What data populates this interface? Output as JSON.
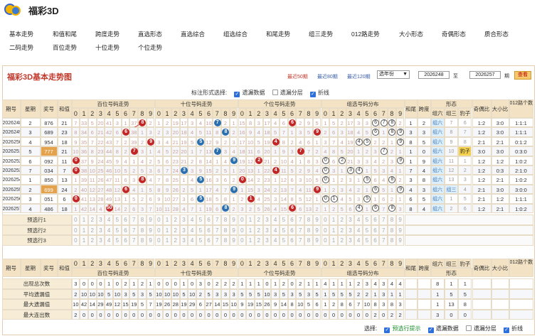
{
  "app": {
    "title": "福彩3D"
  },
  "nav": [
    "基本走势",
    "和值和尾",
    "跨度走势",
    "直选形态",
    "直选综合",
    "组选综合",
    "和尾走势",
    "组三走势",
    "012路走势",
    "大小形态",
    "奇偶形态",
    "质合形态",
    "二码走势",
    "百位走势",
    "十位走势",
    "个位走势"
  ],
  "panel": {
    "title": "福彩3D基本走势图",
    "links": [
      "最近50期",
      "最近80期",
      "最近120期"
    ],
    "year_select": "选年份",
    "from_value": "2026248",
    "to_value": "2026257",
    "to_label": "至",
    "period_label": "期",
    "query_button": "查看"
  },
  "mode": {
    "label": "标注形式选择:",
    "options": [
      {
        "label": "遗漏数据",
        "checked": true
      },
      {
        "label": "遗漏分层",
        "checked": false
      },
      {
        "label": "折线",
        "checked": true
      }
    ]
  },
  "headers": {
    "period": "期号",
    "weekday": "星期",
    "prize": "奖号",
    "sum": "和值",
    "bai": "百位号码走势",
    "shi": "十位号码走势",
    "ge": "个位号码走势",
    "group": "组选号码分布",
    "sumtail": "和尾",
    "span": "跨度",
    "shape": "形态",
    "zu6": "组六",
    "zu3": "组三",
    "leopard": "豹子",
    "odd_even": "奇偶比",
    "big_small": "大小比",
    "road012": "012路个数比"
  },
  "rows": [
    {
      "period": "2026248",
      "weekday": "2",
      "prize": "876",
      "sum": "21",
      "bai": [
        "7",
        "33",
        "5",
        "20",
        "41",
        "3",
        "1",
        "37",
        "8",
        "2"
      ],
      "shi": [
        "1",
        "2",
        "19",
        "17",
        "3",
        "4",
        "10",
        "7",
        "2",
        "1"
      ],
      "ge": [
        "15",
        "8",
        "3",
        "17",
        "4",
        "6",
        "6",
        "2",
        "9",
        "5"
      ],
      "group": [
        "1",
        "5",
        "2",
        "17",
        "3",
        "3",
        "6",
        "7",
        "8",
        "2"
      ],
      "sumtail": "1",
      "span": "2",
      "shape": [
        "组六",
        "7",
        "6"
      ],
      "odd_even": "1:2",
      "big_small": "3:0",
      "road012": "1:1:1"
    },
    {
      "period": "2026249",
      "weekday": "3",
      "prize": "689",
      "sum": "23",
      "bai": [
        "8",
        "34",
        "6",
        "21",
        "42",
        "6",
        "6",
        "38",
        "1",
        "3"
      ],
      "shi": [
        "2",
        "3",
        "20",
        "18",
        "4",
        "5",
        "11",
        "8",
        "8",
        "2"
      ],
      "ge": [
        "16",
        "9",
        "4",
        "18",
        "5",
        "7",
        "1",
        "3",
        "5",
        "9"
      ],
      "group": [
        "2",
        "6",
        "3",
        "18",
        "4",
        "5",
        "6",
        "1",
        "8",
        "9"
      ],
      "sumtail": "3",
      "span": "3",
      "shape": [
        "组六",
        "8",
        "7"
      ],
      "odd_even": "1:2",
      "big_small": "3:0",
      "road012": "1:1:1"
    },
    {
      "period": "2026250",
      "weekday": "4",
      "prize": "954",
      "sum": "18",
      "bai": [
        "9",
        "35",
        "7",
        "22",
        "43",
        "7",
        "2",
        "39",
        "2",
        "9"
      ],
      "shi": [
        "3",
        "4",
        "21",
        "19",
        "5",
        "5",
        "12",
        "9",
        "2",
        "3"
      ],
      "ge": [
        "17",
        "10",
        "5",
        "19",
        "4",
        "8",
        "2",
        "4",
        "6",
        "1"
      ],
      "group": [
        "3",
        "7",
        "4",
        "19",
        "4",
        "5",
        "2",
        "2",
        "1",
        "9"
      ],
      "sumtail": "8",
      "span": "5",
      "shape": [
        "组六",
        "9",
        "8"
      ],
      "odd_even": "2:1",
      "big_small": "2:1",
      "road012": "0:1:2"
    },
    {
      "period": "2026251",
      "weekday": "5",
      "prize": "777",
      "sum": "21",
      "bai": [
        "10",
        "36",
        "8",
        "23",
        "44",
        "8",
        "2",
        "7",
        "3",
        "1"
      ],
      "shi": [
        "4",
        "5",
        "22",
        "20",
        "1",
        "7",
        "13",
        "7",
        "3",
        "4"
      ],
      "ge": [
        "18",
        "11",
        "6",
        "20",
        "1",
        "9",
        "3",
        "7",
        "7",
        "2"
      ],
      "group": [
        "4",
        "8",
        "5",
        "20",
        "1",
        "2",
        "3",
        "7",
        "2",
        "1"
      ],
      "sumtail": "1",
      "span": "0",
      "shape": [
        "组六",
        "10",
        "豹子"
      ],
      "odd_even": "3:0",
      "big_small": "3:0",
      "road012": "0:3:0"
    },
    {
      "period": "2026252",
      "weekday": "6",
      "prize": "092",
      "sum": "11",
      "bai": [
        "0",
        "37",
        "9",
        "24",
        "45",
        "9",
        "4",
        "1",
        "4",
        "2"
      ],
      "shi": [
        "5",
        "6",
        "23",
        "21",
        "2",
        "8",
        "14",
        "1",
        "4",
        "9"
      ],
      "ge": [
        "19",
        "12",
        "2",
        "21",
        "2",
        "10",
        "4",
        "1",
        "8",
        "3"
      ],
      "group": [
        "0",
        "6",
        "2",
        "21",
        "3",
        "3",
        "4",
        "2",
        "3",
        "9"
      ],
      "sumtail": "1",
      "span": "9",
      "shape": [
        "组六",
        "11",
        "1"
      ],
      "odd_even": "1:2",
      "big_small": "1:2",
      "road012": "1:0:2"
    },
    {
      "period": "2026253",
      "weekday": "7",
      "prize": "034",
      "sum": "7",
      "bai": [
        "0",
        "38",
        "10",
        "25",
        "46",
        "10",
        "5",
        "2",
        "5",
        "3"
      ],
      "shi": [
        "6",
        "7",
        "24",
        "3",
        "3",
        "9",
        "15",
        "2",
        "5",
        "1"
      ],
      "ge": [
        "20",
        "13",
        "1",
        "22",
        "4",
        "11",
        "5",
        "2",
        "9",
        "4"
      ],
      "group": [
        "0",
        "3",
        "1",
        "3",
        "4",
        "1",
        "5",
        "3",
        "4",
        "1"
      ],
      "sumtail": "7",
      "span": "4",
      "shape": [
        "组六",
        "12",
        "2"
      ],
      "odd_even": "1:2",
      "big_small": "0:3",
      "road012": "2:1:0"
    },
    {
      "period": "2026254",
      "weekday": "1",
      "prize": "850",
      "sum": "13",
      "bai": [
        "1",
        "39",
        "11",
        "26",
        "47",
        "11",
        "6",
        "3",
        "8",
        "4"
      ],
      "shi": [
        "7",
        "8",
        "25",
        "1",
        "4",
        "5",
        "16",
        "3",
        "6",
        "2"
      ],
      "ge": [
        "0",
        "14",
        "2",
        "23",
        "1",
        "12",
        "6",
        "3",
        "10",
        "5"
      ],
      "group": [
        "0",
        "1",
        "2",
        "3",
        "1",
        "5",
        "6",
        "4",
        "8",
        "2"
      ],
      "sumtail": "3",
      "span": "8",
      "shape": [
        "组六",
        "13",
        "3"
      ],
      "odd_even": "1:2",
      "big_small": "2:1",
      "road012": "1:0:2"
    },
    {
      "period": "2026255",
      "weekday": "2",
      "prize": "699",
      "sum": "24",
      "bai": [
        "2",
        "40",
        "12",
        "27",
        "48",
        "12",
        "6",
        "4",
        "1",
        "5"
      ],
      "shi": [
        "8",
        "9",
        "26",
        "2",
        "5",
        "1",
        "17",
        "4",
        "7",
        "9"
      ],
      "ge": [
        "1",
        "15",
        "3",
        "24",
        "2",
        "13",
        "7",
        "4",
        "11",
        "9"
      ],
      "group": [
        "1",
        "2",
        "3",
        "4",
        "2",
        "1",
        "6",
        "5",
        "1",
        "9"
      ],
      "sumtail": "4",
      "span": "3",
      "shape": [
        "组六",
        "组三",
        "4"
      ],
      "odd_even": "2:1",
      "big_small": "3:0",
      "road012": "3:0:0"
    },
    {
      "period": "2026256",
      "weekday": "3",
      "prize": "051",
      "sum": "6",
      "bai": [
        "0",
        "41",
        "13",
        "28",
        "49",
        "13",
        "1",
        "5",
        "2",
        "6"
      ],
      "shi": [
        "9",
        "10",
        "27",
        "3",
        "6",
        "5",
        "18",
        "5",
        "8",
        "1"
      ],
      "ge": [
        "2",
        "1",
        "4",
        "25",
        "3",
        "14",
        "8",
        "5",
        "12",
        "1"
      ],
      "group": [
        "0",
        "1",
        "4",
        "5",
        "3",
        "5",
        "1",
        "6",
        "2",
        "1"
      ],
      "sumtail": "6",
      "span": "5",
      "shape": [
        "组六",
        "1",
        "5"
      ],
      "odd_even": "2:1",
      "big_small": "1:2",
      "road012": "1:1:1"
    },
    {
      "period": "2026257",
      "weekday": "4",
      "prize": "486",
      "sum": "18",
      "bai": [
        "1",
        "42",
        "14",
        "4",
        "50",
        "14",
        "2",
        "6",
        "3",
        "7"
      ],
      "shi": [
        "10",
        "11",
        "28",
        "4",
        "7",
        "1",
        "19",
        "6",
        "8",
        "2"
      ],
      "ge": [
        "3",
        "2",
        "5",
        "26",
        "4",
        "15",
        "6",
        "6",
        "13",
        "2"
      ],
      "group": [
        "1",
        "2",
        "5",
        "6",
        "4",
        "1",
        "6",
        "7",
        "8",
        "3"
      ],
      "sumtail": "8",
      "span": "4",
      "shape": [
        "组六",
        "2",
        "6"
      ],
      "odd_even": "1:2",
      "big_small": "2:1",
      "road012": "1:0:2"
    }
  ],
  "preselect_rows": [
    "预选行1",
    "预选行2",
    "预选行3"
  ],
  "stats": [
    {
      "label": "出现总次数",
      "values": [
        "3",
        "0",
        "0",
        "0",
        "1",
        "0",
        "2",
        "1",
        "2",
        "1",
        "0",
        "0",
        "0",
        "1",
        "0",
        "3",
        "0",
        "2",
        "2",
        "2",
        "1",
        "1",
        "1",
        "0",
        "1",
        "2",
        "0",
        "2",
        "1",
        "1",
        "4",
        "1",
        "1",
        "1",
        "2",
        "3",
        "4",
        "3",
        "4",
        "4"
      ],
      "tail": [
        "",
        "",
        "8",
        "1",
        "1",
        "",
        "",
        ""
      ]
    },
    {
      "label": "平均遗漏值",
      "values": [
        "2",
        "10",
        "10",
        "10",
        "5",
        "10",
        "3",
        "5",
        "3",
        "5",
        "10",
        "10",
        "10",
        "5",
        "10",
        "2",
        "5",
        "3",
        "3",
        "3",
        "5",
        "5",
        "5",
        "10",
        "3",
        "5",
        "3",
        "5",
        "3",
        "5",
        "1",
        "5",
        "5",
        "5",
        "2",
        "2",
        "1",
        "3",
        "1",
        "1"
      ],
      "tail": [
        "",
        "",
        "1",
        "5",
        "5",
        "",
        "",
        ""
      ]
    },
    {
      "label": "最大遗漏值",
      "values": [
        "10",
        "42",
        "14",
        "29",
        "49",
        "12",
        "15",
        "19",
        "5",
        "7",
        "19",
        "26",
        "28",
        "19",
        "29",
        "6",
        "27",
        "14",
        "15",
        "10",
        "9",
        "19",
        "15",
        "26",
        "9",
        "14",
        "8",
        "10",
        "5",
        "6",
        "1",
        "2",
        "8",
        "6",
        "7",
        "10",
        "8",
        "3",
        "8",
        "3"
      ],
      "tail": [
        "",
        "",
        "1",
        "13",
        "8",
        "",
        "",
        ""
      ]
    },
    {
      "label": "最大连出数",
      "values": [
        "2",
        "0",
        "0",
        "0",
        "0",
        "0",
        "0",
        "0",
        "0",
        "0",
        "0",
        "0",
        "0",
        "0",
        "0",
        "0",
        "0",
        "0",
        "0",
        "0",
        "0",
        "0",
        "0",
        "0",
        "0",
        "0",
        "0",
        "0",
        "0",
        "0",
        "0",
        "0",
        "0",
        "0",
        "0",
        "0",
        "2",
        "0",
        "2",
        "2"
      ],
      "tail": [
        "",
        "",
        "3",
        "0",
        "0",
        "",
        "",
        ""
      ]
    }
  ],
  "footer": {
    "label": "选择:",
    "options": [
      {
        "label": "预选行提示",
        "checked": true
      },
      {
        "label": "遗漏数据",
        "checked": true
      },
      {
        "label": "遗漏分层",
        "checked": false
      },
      {
        "label": "折线",
        "checked": true
      }
    ]
  },
  "colors": {
    "panel_title": "#c0392b",
    "header_bg": "#f3e3c4",
    "label_bg": "#f7ecd5",
    "alt_row": "#f5f7fb",
    "bai_ball": "#c22626",
    "shi_ball": "#2a6fb0",
    "ge_ball": "#c22626",
    "miss": "#c9a29f",
    "shape_fill": "#dcefff",
    "tag_fill": "#f5d24d"
  }
}
